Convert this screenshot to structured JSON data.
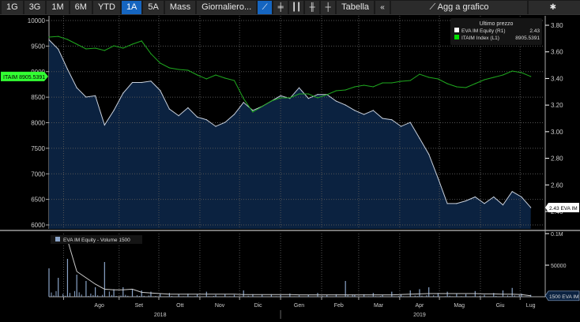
{
  "toolbar": {
    "periods": [
      "1G",
      "3G",
      "1M",
      "6M",
      "YTD",
      "1A",
      "5A",
      "Mass"
    ],
    "selected_period": "1A",
    "frequency": "Giornaliero...",
    "chart_type_icons": [
      "line-chart-icon",
      "candlestick-icon",
      "ohlc-bars-icon",
      "bar-chart-icon",
      "hlc-icon"
    ],
    "table_label": "Tabella",
    "collapse_icon": "double-chevron-left-icon",
    "add_to_chart_label": "Agg a grafico",
    "settings_icon": "gear-icon"
  },
  "legend": {
    "title": "Ultimo prezzo",
    "items": [
      {
        "name": "EVA IM Equity",
        "axis": "(R1)",
        "value": "2.43",
        "color": "#ffffff"
      },
      {
        "name": "ITAIM Index",
        "axis": "(L1)",
        "value": "8905.5391",
        "color": "#00dd00"
      }
    ]
  },
  "volume_legend": "EVA IM Equity - Volume 1500",
  "left_badge": "ITAIM 8905.5391",
  "right_badge": "2.43 EVA IM",
  "volume_badge": "1500 EVA IM",
  "colors": {
    "price_line": "#c8d0dc",
    "price_fill": "#0b2240",
    "index_line": "#1fa81f",
    "volume_bar": "#8aa4c8",
    "badge_green": "#33ff33"
  },
  "chart_data": {
    "type": "line",
    "x": [
      "2018-07-09",
      "2018-07-16",
      "2018-07-23",
      "2018-07-30",
      "2018-08-06",
      "2018-08-13",
      "2018-08-20",
      "2018-08-27",
      "2018-09-03",
      "2018-09-10",
      "2018-09-17",
      "2018-09-24",
      "2018-10-01",
      "2018-10-08",
      "2018-10-15",
      "2018-10-22",
      "2018-10-29",
      "2018-11-05",
      "2018-11-12",
      "2018-11-19",
      "2018-11-26",
      "2018-12-03",
      "2018-12-10",
      "2018-12-17",
      "2018-12-24",
      "2018-12-31",
      "2019-01-07",
      "2019-01-14",
      "2019-01-21",
      "2019-01-28",
      "2019-02-04",
      "2019-02-11",
      "2019-02-18",
      "2019-02-25",
      "2019-03-04",
      "2019-03-11",
      "2019-03-18",
      "2019-03-25",
      "2019-04-01",
      "2019-04-08",
      "2019-04-15",
      "2019-04-22",
      "2019-04-29",
      "2019-05-06",
      "2019-05-13",
      "2019-05-20",
      "2019-05-27",
      "2019-06-03",
      "2019-06-10",
      "2019-06-17",
      "2019-06-24",
      "2019-07-01",
      "2019-07-08"
    ],
    "series": [
      {
        "name": "EVA IM Equity",
        "axis": "right",
        "values": [
          3.69,
          3.62,
          3.47,
          3.33,
          3.26,
          3.27,
          3.05,
          3.16,
          3.29,
          3.37,
          3.37,
          3.38,
          3.31,
          3.17,
          3.12,
          3.18,
          3.11,
          3.09,
          3.04,
          3.07,
          3.13,
          3.22,
          3.16,
          3.19,
          3.23,
          3.27,
          3.25,
          3.33,
          3.25,
          3.28,
          3.28,
          3.23,
          3.2,
          3.16,
          3.13,
          3.16,
          3.1,
          3.09,
          3.04,
          3.07,
          2.95,
          2.83,
          2.65,
          2.46,
          2.46,
          2.48,
          2.51,
          2.46,
          2.51,
          2.45,
          2.55,
          2.51,
          2.43
        ]
      },
      {
        "name": "ITAIM Index",
        "axis": "left",
        "values": [
          9676,
          9690,
          9630,
          9537,
          9444,
          9460,
          9413,
          9506,
          9460,
          9537,
          9600,
          9350,
          9166,
          9074,
          9043,
          9027,
          8935,
          8857,
          8935,
          8873,
          8827,
          8472,
          8210,
          8317,
          8425,
          8487,
          8487,
          8564,
          8564,
          8487,
          8549,
          8626,
          8641,
          8703,
          8734,
          8703,
          8780,
          8780,
          8811,
          8827,
          8950,
          8888,
          8857,
          8765,
          8703,
          8688,
          8765,
          8842,
          8888,
          8935,
          9012,
          8981,
          8905.5391
        ]
      }
    ],
    "volume": {
      "name": "EVA IM Equity - Volume",
      "values": [
        45000,
        30000,
        60000,
        35000,
        25000,
        15000,
        55000,
        12000,
        15000,
        12000,
        10000,
        8000,
        5000,
        6000,
        4000,
        5000,
        4000,
        8000,
        3000,
        4000,
        3000,
        10000,
        4000,
        3000,
        4000,
        3000,
        5000,
        2000,
        3000,
        6000,
        3000,
        4000,
        25000,
        3000,
        4000,
        6000,
        3000,
        8000,
        4000,
        10000,
        12000,
        15000,
        6000,
        8000,
        5000,
        4000,
        9000,
        3000,
        6000,
        10000,
        14000,
        5000,
        3000
      ],
      "moving_average": [
        null,
        null,
        90000,
        40000,
        30000,
        20000,
        12000,
        11000,
        11000,
        12000,
        7000,
        6000,
        5000,
        4000,
        4000,
        4000,
        4000,
        4000,
        4000,
        4000,
        4000,
        3500,
        3500,
        3500,
        3500,
        3500,
        3500,
        3000,
        3000,
        3000,
        3000,
        3000,
        3000,
        3000,
        3000,
        3000,
        3000,
        3000,
        3500,
        4000,
        4500,
        5000,
        5000,
        5000,
        5000,
        5000,
        5000,
        4500,
        4500,
        4000,
        4000,
        3500,
        1500
      ],
      "ylim": [
        0,
        100000
      ],
      "ticks": [
        {
          "value": 100000,
          "label": "0.1M"
        },
        {
          "value": 50000,
          "label": "50000"
        }
      ]
    },
    "left_axis": {
      "ylim": [
        6000,
        10000
      ],
      "ticks": [
        "10000",
        "9500",
        "9000",
        "8500",
        "8000",
        "7500",
        "7000",
        "6500",
        "6000"
      ]
    },
    "right_axis": {
      "ylim": [
        2.3,
        3.86
      ],
      "ticks": [
        "3.80",
        "3.60",
        "3.40",
        "3.20",
        "3.00",
        "2.80",
        "2.60",
        "2.40"
      ]
    },
    "xlim": [
      "2018-07-09",
      "2019-07-10"
    ],
    "months": [
      {
        "label": "Ago",
        "date": "2018-08-16"
      },
      {
        "label": "Set",
        "date": "2018-09-15"
      },
      {
        "label": "Ott",
        "date": "2018-10-16"
      },
      {
        "label": "Nov",
        "date": "2018-11-15"
      },
      {
        "label": "Dic",
        "date": "2018-12-14"
      },
      {
        "label": "Gen",
        "date": "2019-01-14"
      },
      {
        "label": "Feb",
        "date": "2019-02-13"
      },
      {
        "label": "Mar",
        "date": "2019-03-15"
      },
      {
        "label": "Apr",
        "date": "2019-04-15"
      },
      {
        "label": "Mag",
        "date": "2019-05-15"
      },
      {
        "label": "Giu",
        "date": "2019-06-15"
      },
      {
        "label": "Lug",
        "date": "2019-07-08"
      }
    ],
    "years": [
      {
        "label": "2018",
        "date": "2018-10-01"
      },
      {
        "label": "2019",
        "date": "2019-04-15"
      }
    ],
    "grid": true,
    "legend_position": "top-right"
  }
}
